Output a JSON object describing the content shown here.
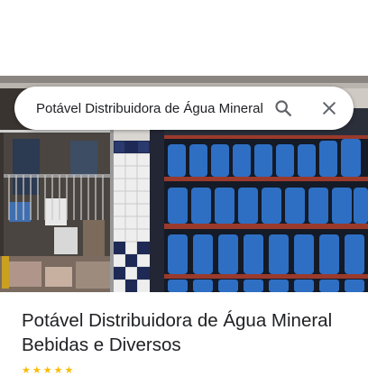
{
  "search": {
    "value": "Potável Distribuidora de Água Mineral Bebidas e Diversos",
    "search_icon": "search-icon",
    "close_icon": "close-icon"
  },
  "place": {
    "title": "Potável Distribuidora de Água Mineral Bebidas e Diversos",
    "photo": "storefront-photo",
    "rating_color": "#fbbc04"
  },
  "colors": {
    "jug_blue": "#2e6fc4",
    "rack_red": "#9a3a2c",
    "tile_white": "#f2f2f2",
    "tile_navy": "#1e2a55"
  }
}
